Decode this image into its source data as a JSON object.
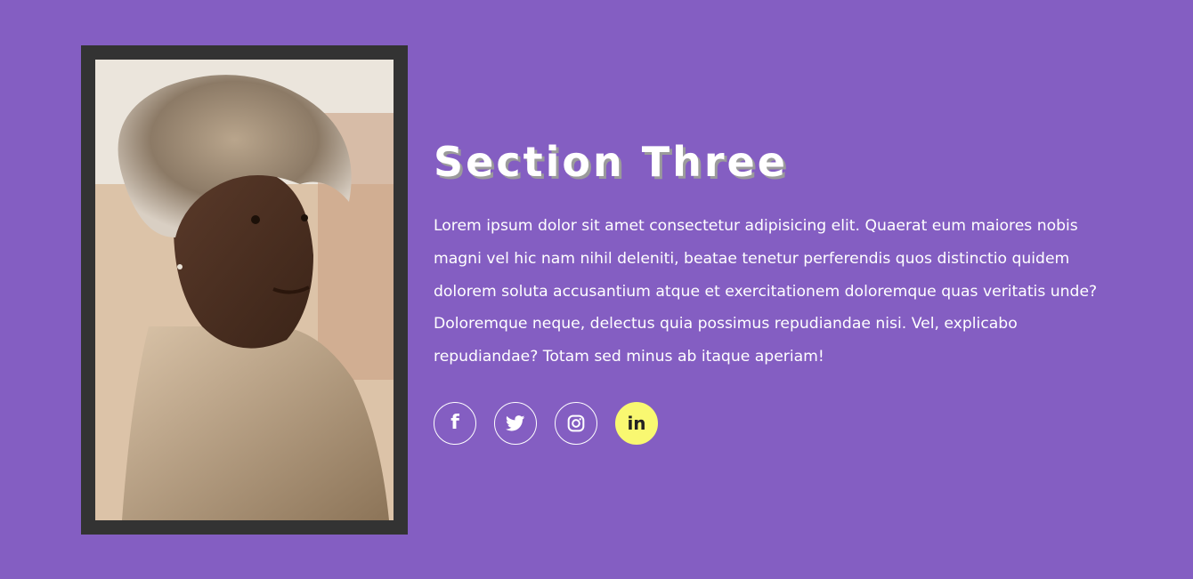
{
  "section": {
    "title": "Section Three",
    "body": "Lorem ipsum dolor sit amet consectetur adipisicing elit. Quaerat eum maiores nobis magni vel hic nam nihil deleniti, beatae tenetur perferendis quos distinctio quidem dolorem soluta accusantium atque et exercitationem doloremque quas veritatis unde? Doloremque neque, delectus quia possimus repudiandae nisi. Vel, explicabo repudiandae? Totam sed minus ab itaque aperiam!"
  },
  "socials": [
    {
      "icon": "facebook-icon",
      "glyph": "f"
    },
    {
      "icon": "twitter-icon",
      "glyph": ""
    },
    {
      "icon": "instagram-icon",
      "glyph": ""
    },
    {
      "icon": "linkedin-icon",
      "glyph": "in"
    }
  ],
  "colors": {
    "background": "#845ec2",
    "frame": "#333333",
    "accent": "#f9f871",
    "text": "#ffffff"
  }
}
